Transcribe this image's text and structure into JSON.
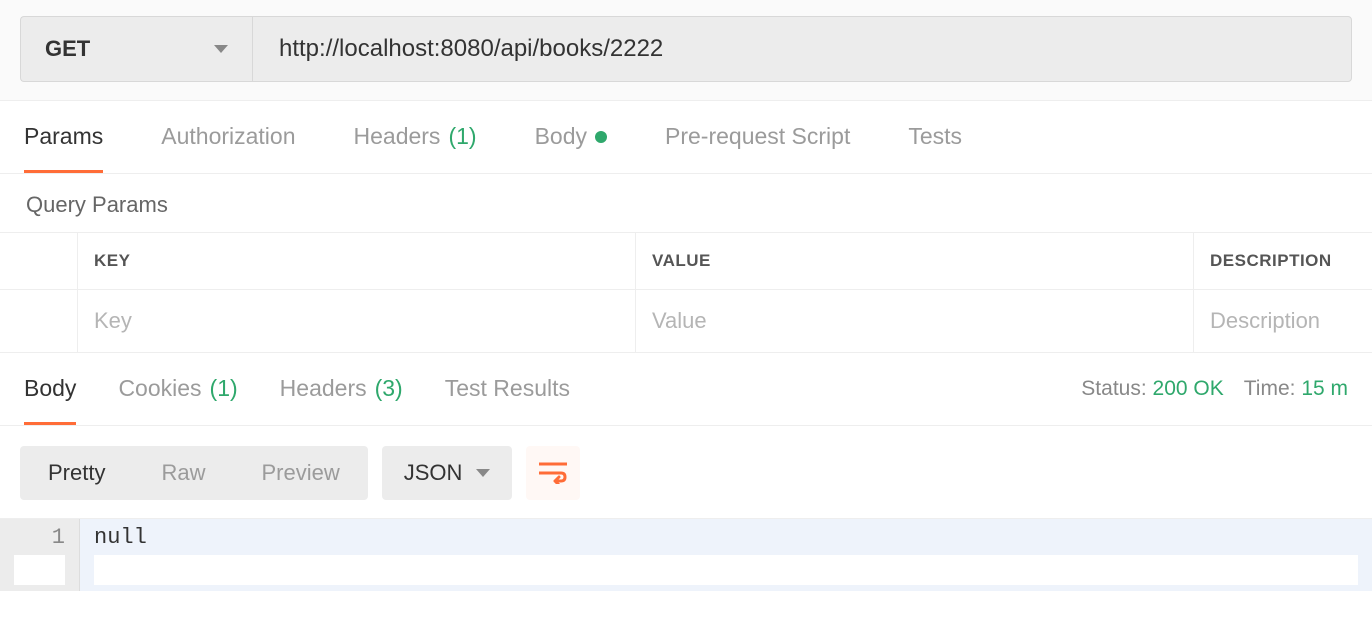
{
  "request": {
    "method": "GET",
    "url": "http://localhost:8080/api/books/2222"
  },
  "tabs": [
    {
      "label": "Params",
      "active": true
    },
    {
      "label": "Authorization"
    },
    {
      "label": "Headers",
      "count": "(1)"
    },
    {
      "label": "Body",
      "dot": true
    },
    {
      "label": "Pre-request Script"
    },
    {
      "label": "Tests"
    }
  ],
  "queryParams": {
    "title": "Query Params",
    "headers": {
      "key": "KEY",
      "value": "VALUE",
      "desc": "DESCRIPTION"
    },
    "placeholders": {
      "key": "Key",
      "value": "Value",
      "desc": "Description"
    }
  },
  "responseTabs": [
    {
      "label": "Body",
      "active": true
    },
    {
      "label": "Cookies",
      "count": "(1)"
    },
    {
      "label": "Headers",
      "count": "(3)"
    },
    {
      "label": "Test Results"
    }
  ],
  "status": {
    "statusLabel": "Status:",
    "statusValue": "200 OK",
    "timeLabel": "Time:",
    "timeValue": "15 m"
  },
  "bodyToolbar": {
    "pretty": "Pretty",
    "raw": "Raw",
    "preview": "Preview",
    "format": "JSON"
  },
  "responseBody": {
    "lineNumber": "1",
    "content": "null"
  }
}
